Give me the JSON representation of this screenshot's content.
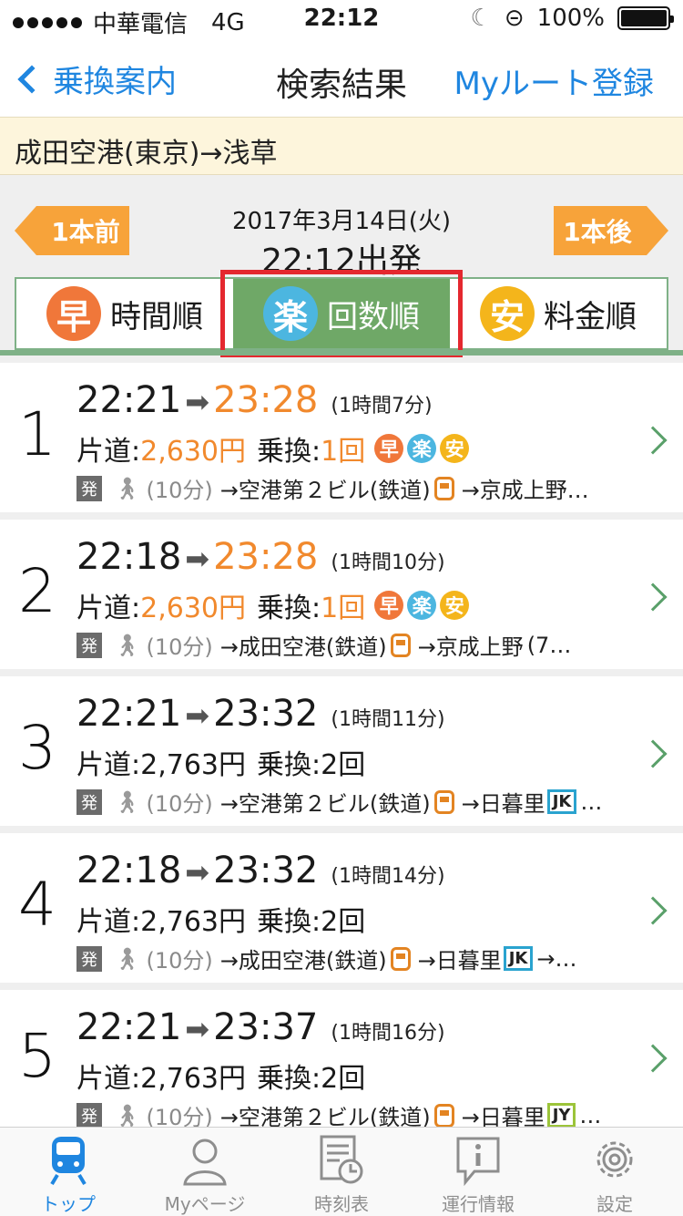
{
  "status": {
    "carrier": "中華電信",
    "network": "4G",
    "time": "22:12",
    "battery": "100%"
  },
  "nav": {
    "back": "乗換案内",
    "title": "検索結果",
    "right": "Myルート登録"
  },
  "route": "成田空港(東京)→浅草",
  "date": {
    "prev": "1本前",
    "next": "1本後",
    "date": "2017年3月14日(火)",
    "time": "22:12出発"
  },
  "tabs": [
    {
      "badge": "早",
      "label": "時間順",
      "color": "#f0773a"
    },
    {
      "badge": "楽",
      "label": "回数順",
      "color": "#4cb6e0"
    },
    {
      "badge": "安",
      "label": "料金順",
      "color": "#f4b51b"
    }
  ],
  "results": [
    {
      "no": "1",
      "dep": "22:21",
      "arr": "23:28",
      "dur": "(1時間7分)",
      "fare": "2,630円",
      "transfer": "1回",
      "badges": [
        "早",
        "楽",
        "安"
      ],
      "start": "発",
      "walk": "(10分)",
      "stop1": "→空港第２ビル(鉄道)",
      "stop2": "→京成上野…",
      "line": ""
    },
    {
      "no": "2",
      "dep": "22:18",
      "arr": "23:28",
      "dur": "(1時間10分)",
      "fare": "2,630円",
      "transfer": "1回",
      "badges": [
        "早",
        "楽",
        "安"
      ],
      "start": "発",
      "walk": "(10分)",
      "stop1": "→成田空港(鉄道)",
      "stop2": "→京成上野",
      "tail": "(7…",
      "line": ""
    },
    {
      "no": "3",
      "dep": "22:21",
      "arr": "23:32",
      "dur": "(1時間11分)",
      "fare": "2,763円",
      "transfer": "2回",
      "badges": [],
      "start": "発",
      "walk": "(10分)",
      "stop1": "→空港第２ビル(鉄道)",
      "stop2": "→日暮里",
      "line": "JK",
      "tail": "…"
    },
    {
      "no": "4",
      "dep": "22:18",
      "arr": "23:32",
      "dur": "(1時間14分)",
      "fare": "2,763円",
      "transfer": "2回",
      "badges": [],
      "start": "発",
      "walk": "(10分)",
      "stop1": "→成田空港(鉄道)",
      "stop2": "→日暮里",
      "line": "JK",
      "tail": "→…"
    },
    {
      "no": "5",
      "dep": "22:21",
      "arr": "23:37",
      "dur": "(1時間16分)",
      "fare": "2,763円",
      "transfer": "2回",
      "badges": [],
      "start": "発",
      "walk": "(10分)",
      "stop1": "→空港第２ビル(鉄道)",
      "stop2": "→日暮里",
      "line": "JY",
      "tail": "…"
    }
  ],
  "labels": {
    "fare": "片道:",
    "transfer": "乗換:"
  },
  "tabbar": [
    {
      "label": "トップ",
      "icon": "train-icon"
    },
    {
      "label": "Myページ",
      "icon": "person-icon"
    },
    {
      "label": "時刻表",
      "icon": "timetable-icon"
    },
    {
      "label": "運行情報",
      "icon": "info-icon"
    },
    {
      "label": "設定",
      "icon": "gear-icon"
    }
  ]
}
